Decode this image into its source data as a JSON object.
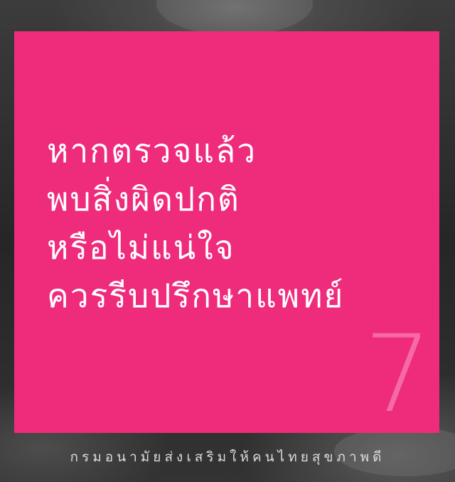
{
  "headline": {
    "lines": [
      "หากตรวจแล้ว",
      "พบสิ่งผิดปกติ",
      "หรือไม่แน่ใจ",
      "ควรรีบปรึกษาแพทย์"
    ]
  },
  "page_number": "7",
  "footer": "กรมอนามัยส่งเสริมให้คนไทยสุขภาพดี",
  "colors": {
    "card": "#ef2b7c",
    "headline_text": "#ffffff",
    "page_number": "#f56aa6",
    "background": "#2a2a2a",
    "footer_text": "#dcdcdc"
  }
}
